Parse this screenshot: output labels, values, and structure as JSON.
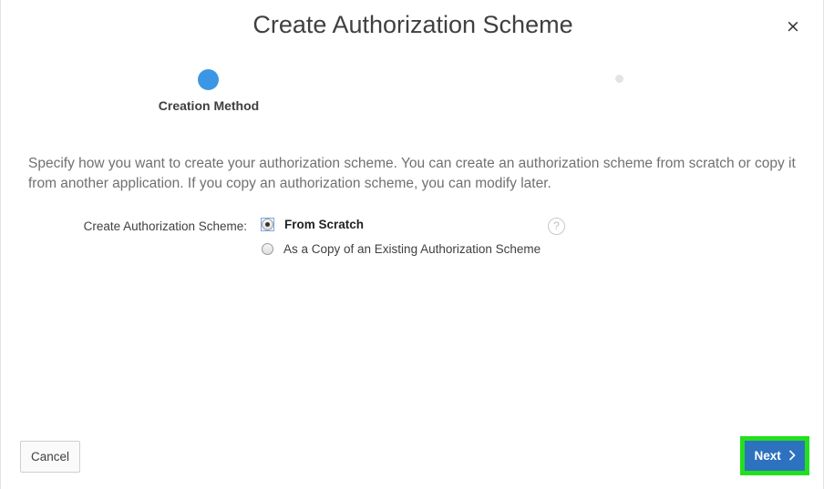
{
  "dialog": {
    "title": "Create Authorization Scheme",
    "close_label": "×"
  },
  "wizard": {
    "steps": [
      {
        "label": "Creation Method",
        "state": "active"
      },
      {
        "label": "",
        "state": "inactive"
      }
    ]
  },
  "instructions": "Specify how you want to create your authorization scheme. You can create an authorization scheme from scratch or copy it from another application. If you copy an authorization scheme, you can modify later.",
  "form": {
    "field_label": "Create Authorization Scheme:",
    "options": [
      {
        "label": "From Scratch",
        "selected": true
      },
      {
        "label": "As a Copy of an Existing Authorization Scheme",
        "selected": false
      }
    ],
    "help_icon": "?"
  },
  "footer": {
    "cancel_label": "Cancel",
    "next_label": "Next"
  },
  "colors": {
    "accent": "#3b97e3",
    "primary_button": "#2d72bf",
    "highlight_outline": "#22e01d"
  },
  "icons": {
    "close": "close-icon",
    "help": "help-icon",
    "next": "chevron-right-icon"
  }
}
